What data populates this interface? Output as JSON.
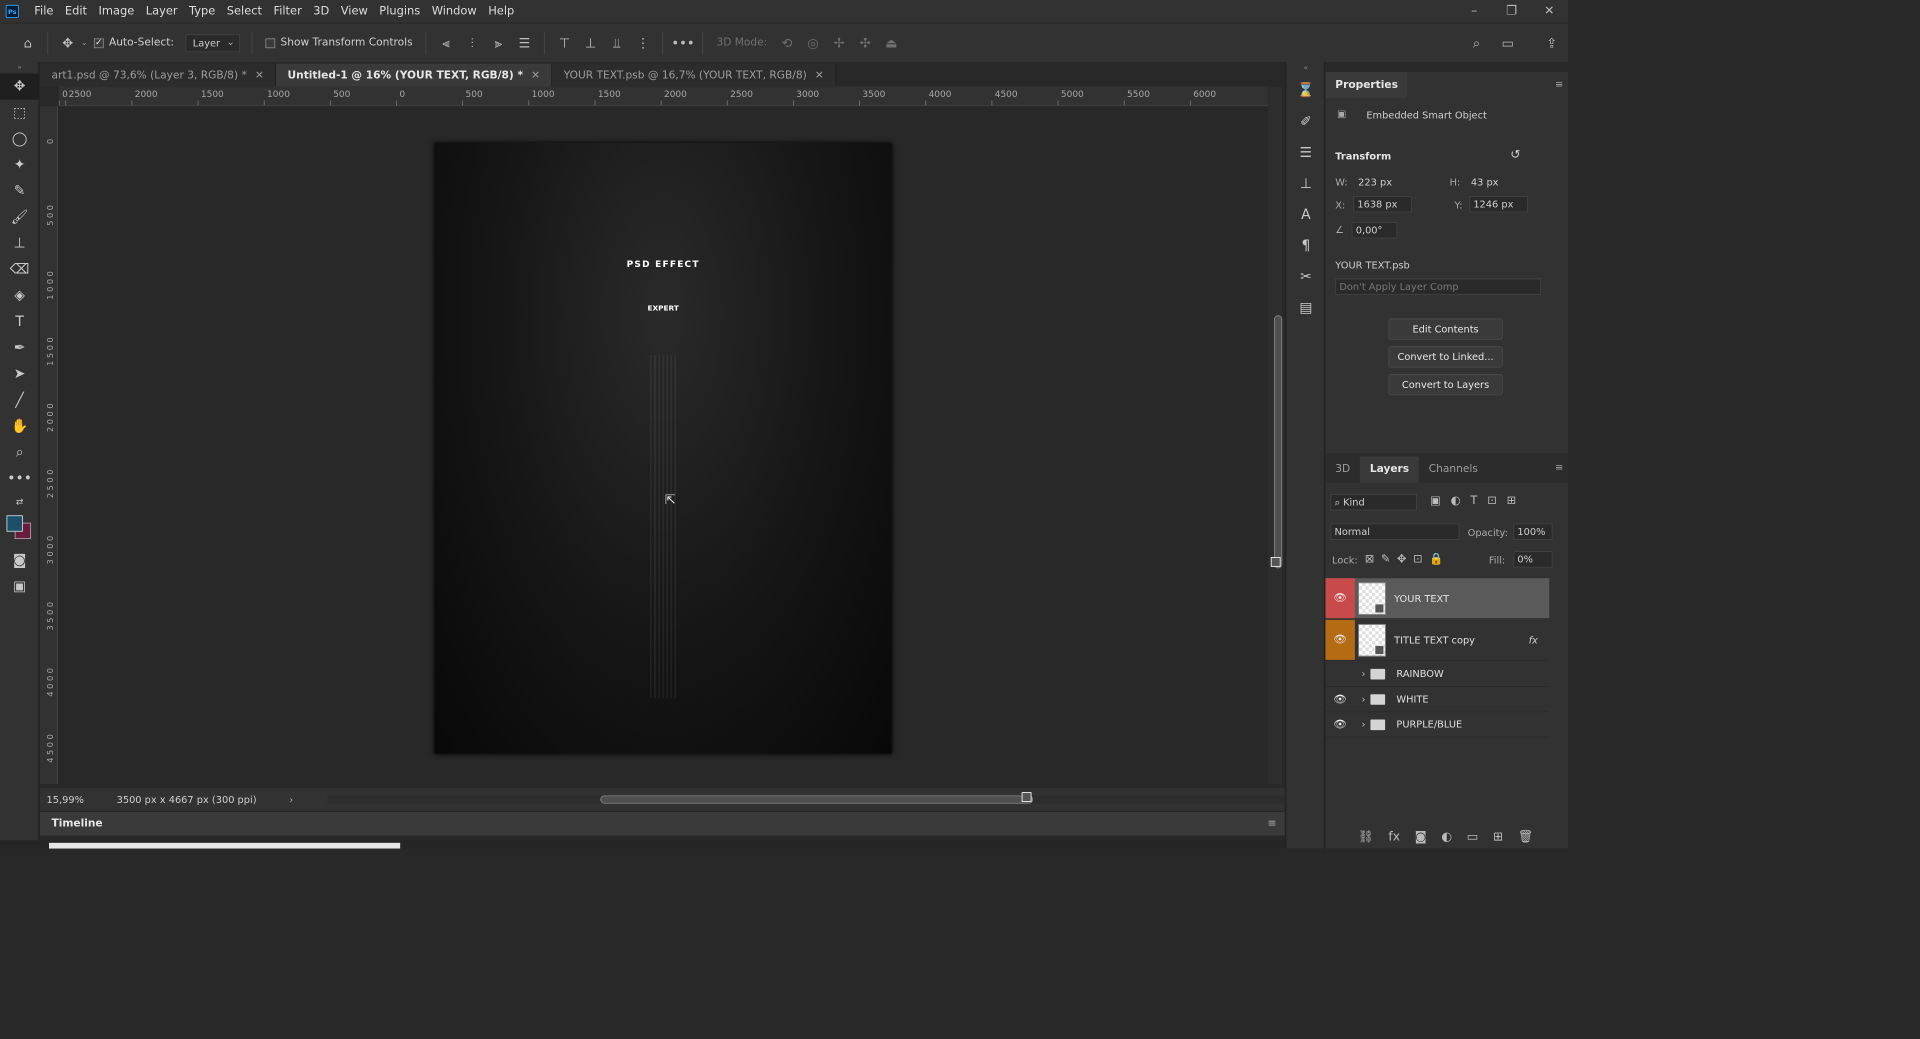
{
  "menu": [
    "File",
    "Edit",
    "Image",
    "Layer",
    "Type",
    "Select",
    "Filter",
    "3D",
    "View",
    "Plugins",
    "Window",
    "Help"
  ],
  "options": {
    "auto_select_label": "Auto-Select:",
    "auto_select_value": "Layer",
    "transform_label": "Show Transform Controls",
    "mode_label": "3D Mode:"
  },
  "tabs": [
    {
      "label": "art1.psd @ 73,6% (Layer 3, RGB/8) *"
    },
    {
      "label": "Untitled-1 @ 16% (YOUR TEXT, RGB/8) *"
    },
    {
      "label": "YOUR TEXT.psb @ 16,7% (YOUR TEXT, RGB/8)"
    }
  ],
  "ruler_top": [
    "0",
    "2500",
    "2000",
    "1500",
    "1000",
    "500",
    "0",
    "500",
    "1000",
    "1500",
    "2000",
    "2500",
    "3000",
    "3500",
    "4000",
    "4500",
    "5000",
    "5500",
    "6000"
  ],
  "ruler_left": [
    "0",
    "5 0 0",
    "1 0 0 0",
    "1 5 0 0",
    "2 0 0 0",
    "2 5 0 0",
    "3 0 0 0",
    "3 5 0 0",
    "4 0 0 0",
    "4 5 0 0"
  ],
  "document": {
    "title": "PSD EFFECT",
    "subtitle": "EXPERT"
  },
  "status": {
    "zoom": "15,99%",
    "info": "3500 px x 4667 px (300 ppi)"
  },
  "timeline_label": "Timeline",
  "properties": {
    "tab": "Properties",
    "object_type": "Embedded Smart Object",
    "section": "Transform",
    "w_label": "W:",
    "w": "223 px",
    "h_label": "H:",
    "h": "43 px",
    "x_label": "X:",
    "x": "1638 px",
    "y_label": "Y:",
    "y": "1246 px",
    "angle": "0,00°",
    "file": "YOUR TEXT.psb",
    "comp": "Don't Apply Layer Comp",
    "btn_edit": "Edit Contents",
    "btn_linked": "Convert to Linked...",
    "btn_layers": "Convert to Layers"
  },
  "layers_panel": {
    "tabs": [
      "3D",
      "Layers",
      "Channels"
    ],
    "kind": "Kind",
    "blend": "Normal",
    "opacity_label": "Opacity:",
    "opacity": "100%",
    "lock_label": "Lock:",
    "fill_label": "Fill:",
    "fill": "0%",
    "layers": [
      {
        "name": "YOUR TEXT",
        "color": "#c94a4a"
      },
      {
        "name": "TITLE TEXT copy",
        "color": "#b56a14",
        "fx": "fx"
      },
      {
        "name": "RAINBOW"
      },
      {
        "name": "WHITE"
      },
      {
        "name": "PURPLE/BLUE"
      }
    ]
  },
  "colors": {
    "foreground": "#1c4f6a",
    "background": "#6a1c3e"
  }
}
